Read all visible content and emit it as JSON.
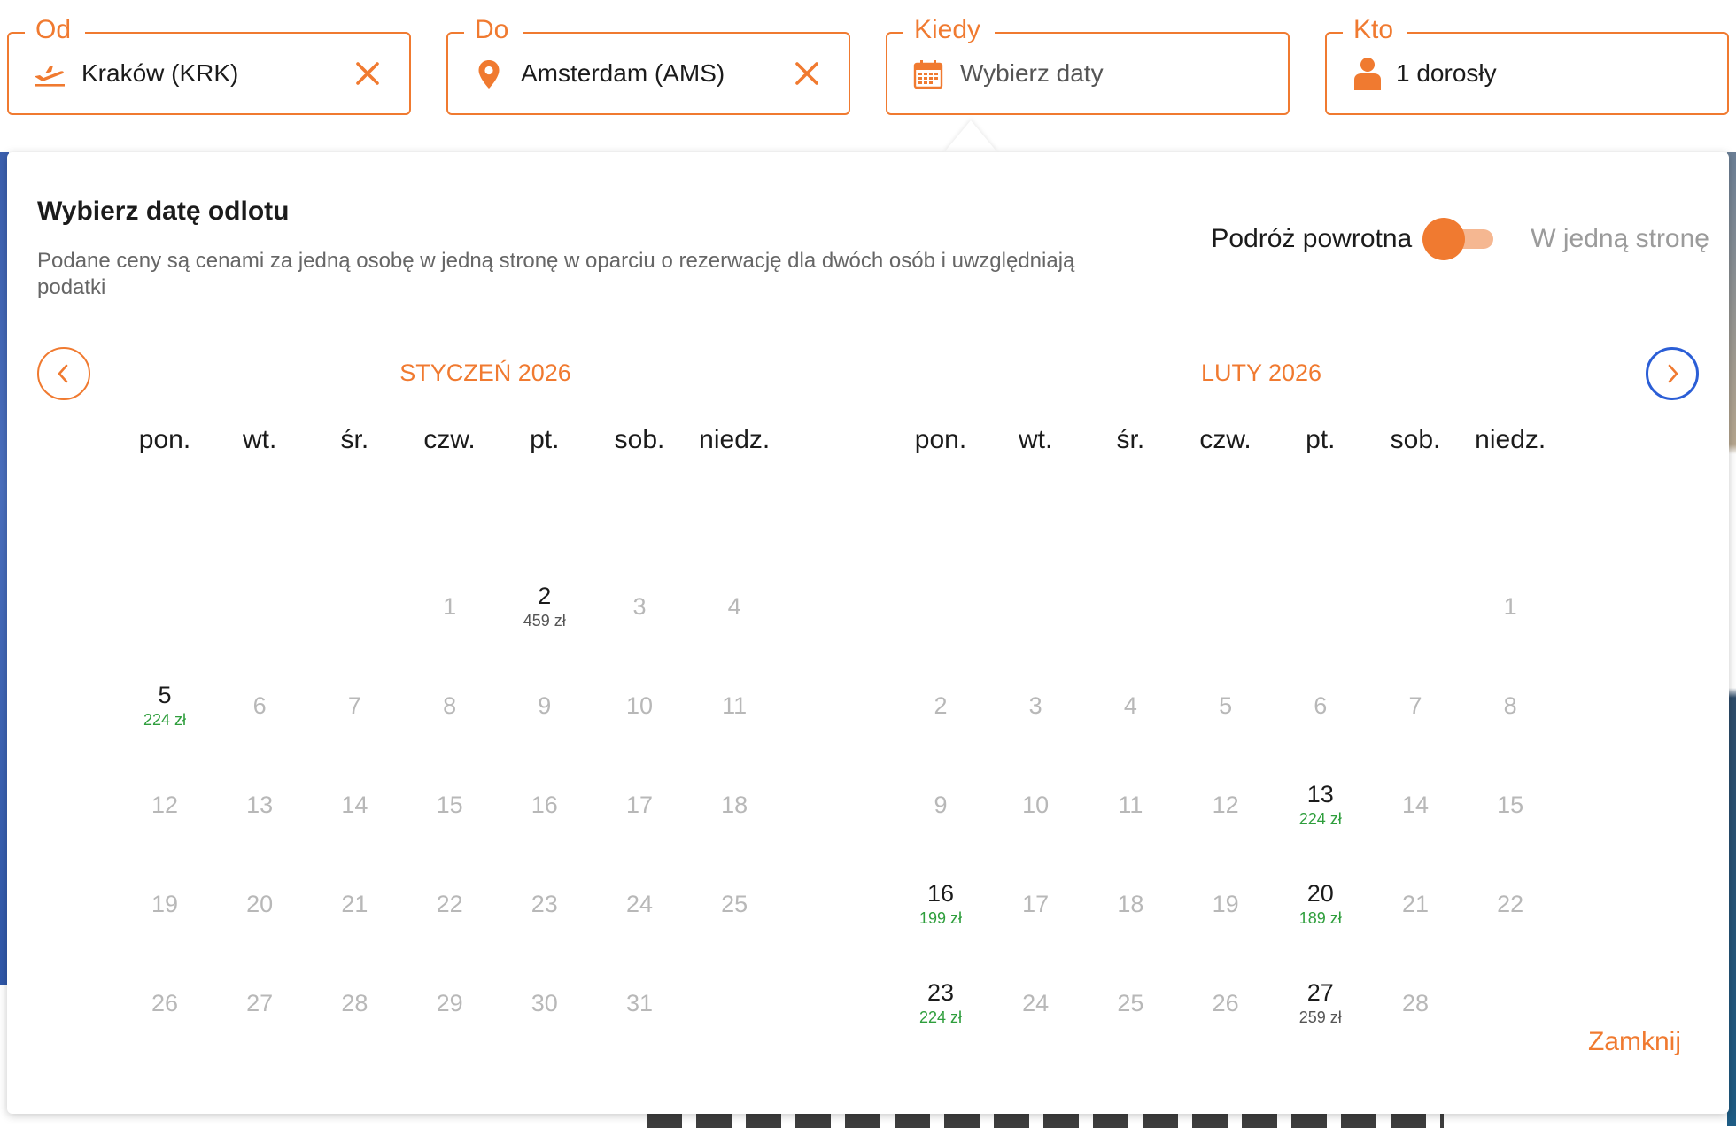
{
  "colors": {
    "accent": "#f07a30",
    "price_low": "#2e9e3c",
    "price_normal": "#555555",
    "next_button_ring": "#2b5ed6"
  },
  "search": {
    "from": {
      "label": "Od",
      "value": "Kraków (KRK)",
      "icon": "plane-takeoff-icon",
      "clear_icon": "close-icon"
    },
    "to": {
      "label": "Do",
      "value": "Amsterdam (AMS)",
      "icon": "map-pin-icon",
      "clear_icon": "close-icon"
    },
    "when": {
      "label": "Kiedy",
      "placeholder": "Wybierz daty",
      "icon": "calendar-icon"
    },
    "who": {
      "label": "Kto",
      "value": "1 dorosły",
      "icon": "person-icon"
    }
  },
  "popup": {
    "title": "Wybierz datę odlotu",
    "note": "Podane ceny są cenami za jedną osobę w jedną stronę w oparciu o rezerwację dla dwóch osób i uwzględniają podatki",
    "trip_toggle": {
      "left_label": "Podróż powrotna",
      "right_label": "W jedną stronę",
      "selected": "Podróż powrotna"
    },
    "prev_icon": "chevron-left-icon",
    "next_icon": "chevron-right-icon",
    "close_label": "Zamknij"
  },
  "weekdays": [
    "pon.",
    "wt.",
    "śr.",
    "czw.",
    "pt.",
    "sob.",
    "niedz."
  ],
  "months": [
    {
      "title": "STYCZEŃ 2026",
      "weeks": [
        [
          null,
          null,
          {
            "d": "1"
          },
          {
            "d": "2",
            "price": "459 zł",
            "tone": "normal"
          },
          {
            "d": "3"
          },
          {
            "d": "4"
          }
        ],
        [
          {
            "d": "5",
            "price": "224 zł",
            "tone": "low"
          },
          {
            "d": "6"
          },
          {
            "d": "7"
          },
          {
            "d": "8"
          },
          {
            "d": "9"
          },
          {
            "d": "10"
          },
          {
            "d": "11"
          }
        ],
        [
          {
            "d": "12"
          },
          {
            "d": "13"
          },
          {
            "d": "14"
          },
          {
            "d": "15"
          },
          {
            "d": "16"
          },
          {
            "d": "17"
          },
          {
            "d": "18"
          }
        ],
        [
          {
            "d": "19"
          },
          {
            "d": "20"
          },
          {
            "d": "21"
          },
          {
            "d": "22"
          },
          {
            "d": "23"
          },
          {
            "d": "24"
          },
          {
            "d": "25"
          }
        ],
        [
          {
            "d": "26"
          },
          {
            "d": "27"
          },
          {
            "d": "28"
          },
          {
            "d": "29"
          },
          {
            "d": "30"
          },
          {
            "d": "31"
          },
          null
        ]
      ]
    },
    {
      "title": "LUTY 2026",
      "weeks": [
        [
          null,
          null,
          null,
          null,
          null,
          null,
          {
            "d": "1"
          }
        ],
        [
          {
            "d": "2"
          },
          {
            "d": "3"
          },
          {
            "d": "4"
          },
          {
            "d": "5"
          },
          {
            "d": "6"
          },
          {
            "d": "7"
          },
          {
            "d": "8"
          }
        ],
        [
          {
            "d": "9"
          },
          {
            "d": "10"
          },
          {
            "d": "11"
          },
          {
            "d": "12"
          },
          {
            "d": "13",
            "price": "224 zł",
            "tone": "low"
          },
          {
            "d": "14"
          },
          {
            "d": "15"
          }
        ],
        [
          {
            "d": "16",
            "price": "199 zł",
            "tone": "low"
          },
          {
            "d": "17"
          },
          {
            "d": "18"
          },
          {
            "d": "19"
          },
          {
            "d": "20",
            "price": "189 zł",
            "tone": "low"
          },
          {
            "d": "21"
          },
          {
            "d": "22"
          }
        ],
        [
          {
            "d": "23",
            "price": "224 zł",
            "tone": "low"
          },
          {
            "d": "24"
          },
          {
            "d": "25"
          },
          {
            "d": "26"
          },
          {
            "d": "27",
            "price": "259 zł",
            "tone": "normal"
          },
          {
            "d": "28"
          },
          null
        ]
      ]
    }
  ]
}
